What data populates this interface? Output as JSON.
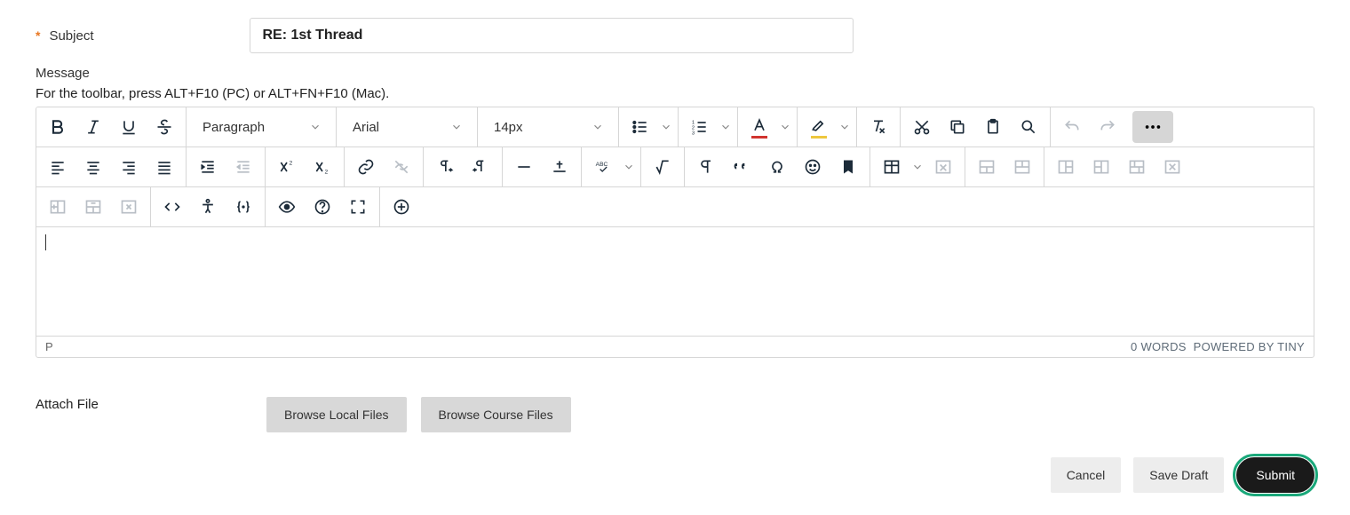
{
  "subject": {
    "required": "*",
    "label": "Subject",
    "value": "RE: 1st Thread"
  },
  "message": {
    "label": "Message",
    "hint": "For the toolbar, press ALT+F10 (PC) or ALT+FN+F10 (Mac)."
  },
  "toolbar": {
    "block_format": "Paragraph",
    "font_family": "Arial",
    "font_size": "14px"
  },
  "status": {
    "path": "P",
    "words": "0 WORDS",
    "branding": "POWERED BY TINY"
  },
  "attach": {
    "label": "Attach File",
    "browse_local": "Browse Local Files",
    "browse_course": "Browse Course Files"
  },
  "actions": {
    "cancel": "Cancel",
    "save_draft": "Save Draft",
    "submit": "Submit"
  }
}
